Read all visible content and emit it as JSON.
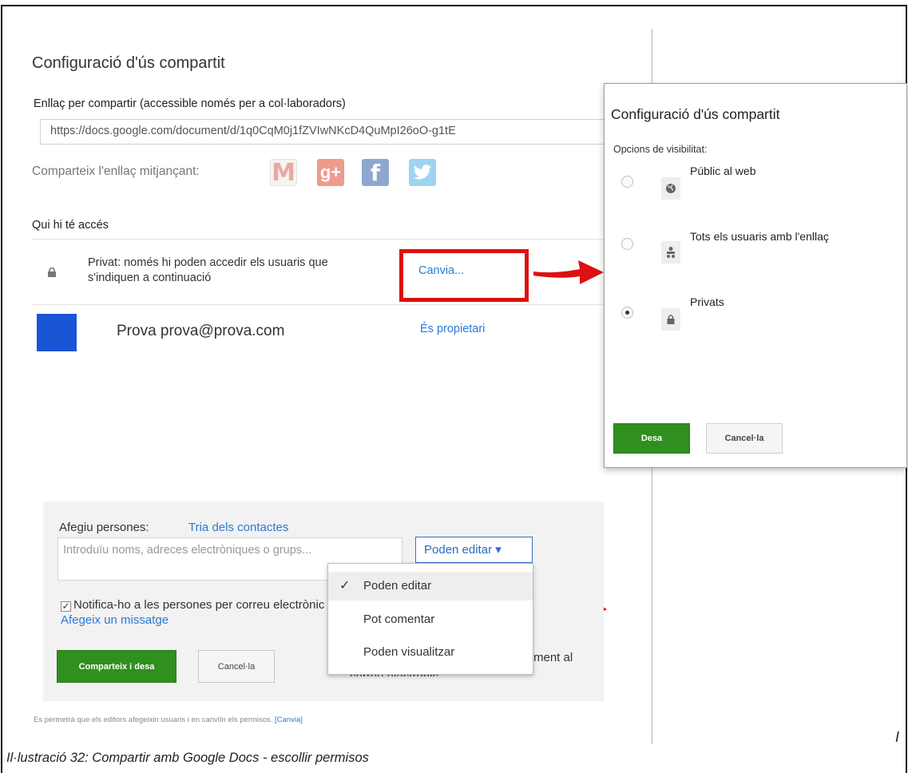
{
  "main": {
    "title": "Configuració d'ús compartit",
    "link_label": "Enllaç per compartir (accessible només per a col·laboradors)",
    "link_url": "https://docs.google.com/document/d/1q0CqM0j1fZVIwNKcD4QuMpI26oO-g1tE",
    "share_via_label": "Comparteix l'enllaç mitjançant:",
    "share_icons": [
      "gmail-icon",
      "google-plus-icon",
      "facebook-icon",
      "twitter-icon"
    ],
    "access_heading": "Qui hi té accés",
    "privacy_text": "Privat: només hi poden accedir els usuaris que s'indiquen a continuació",
    "change_link": "Canvia...",
    "owner_name": "Prova prova@prova.com",
    "owner_role": "És propietari",
    "footnote": "Es permetrà que els editors afegeixin usuaris i en canviïn els permisos.",
    "footnote_link": "[Canvia]"
  },
  "add_people": {
    "label": "Afegiu persones:",
    "pick_contacts": "Tria dels contactes",
    "input_placeholder": "Introduïu noms, adreces electròniques o grups...",
    "permission_button": "Poden editar ▾",
    "notify_text": "Notifica-ho a les persones per correu electrònic - ",
    "add_message_link": "Afegeix un missatge",
    "share_button": "Comparteix i desa",
    "cancel_button": "Cancel·la",
    "hidden_text_1": "ment al",
    "hidden_text_2": "correu electrònic"
  },
  "permission_menu": {
    "items": [
      {
        "label": "Poden editar",
        "selected": true
      },
      {
        "label": "Pot comentar",
        "selected": false
      },
      {
        "label": "Poden visualitzar",
        "selected": false
      }
    ]
  },
  "visibility_dialog": {
    "title": "Configuració d'ús compartit",
    "options_label": "Opcions de visibilitat:",
    "options": [
      {
        "label": "Públic al web",
        "icon": "globe-icon",
        "selected": false
      },
      {
        "label": "Tots els usuaris amb l'enllaç",
        "icon": "people-icon",
        "selected": false
      },
      {
        "label": "Privats",
        "icon": "lock-icon",
        "selected": true
      }
    ],
    "save_button": "Desa",
    "cancel_button": "Cancel·la"
  },
  "caption": "Il·lustració 32: Compartir amb Google Docs - escollir permisos",
  "stray_char": "I",
  "colors": {
    "accent_red": "#dd1111",
    "link_blue": "#2a7ad4",
    "button_green": "#2f8f1f",
    "avatar_blue": "#1a55d6"
  }
}
